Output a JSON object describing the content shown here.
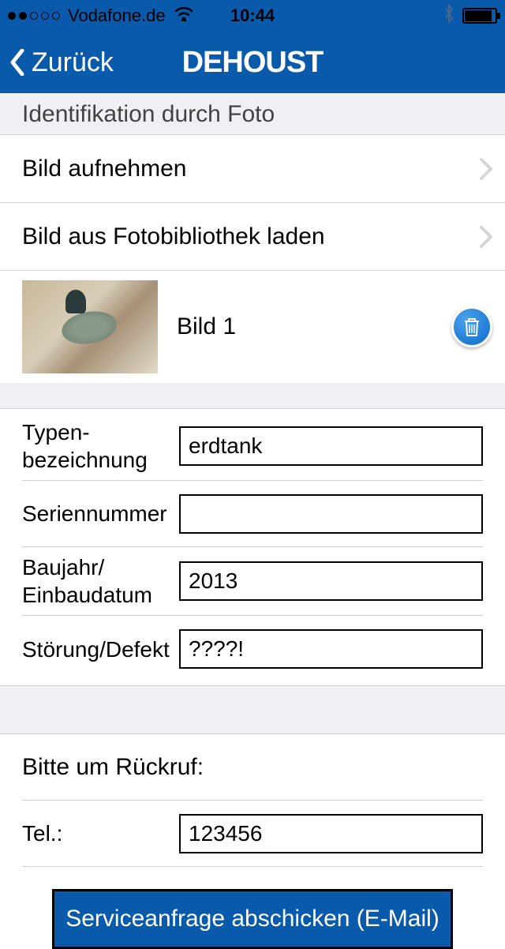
{
  "status": {
    "carrier": "Vodafone.de",
    "time": "10:44"
  },
  "nav": {
    "back": "Zurück",
    "title": "DEHOUST"
  },
  "photo_section": {
    "header": "Identifikation durch Foto",
    "take_photo": "Bild aufnehmen",
    "load_photo": "Bild aus Fotobibliothek laden",
    "image_label": "Bild 1"
  },
  "form": {
    "type_label": "Typen-\nbezeichnung",
    "type_value": "erdtank",
    "serial_label": "Seriennummer",
    "serial_value": "",
    "year_label": "Baujahr/\nEinbaudatum",
    "year_value": "2013",
    "defect_label": "Störung/Defekt",
    "defect_value": "????!"
  },
  "callback": {
    "title": "Bitte um Rückruf:",
    "tel_label": "Tel.:",
    "tel_value": "123456"
  },
  "submit": {
    "label": "Serviceanfrage abschicken (E-Mail)"
  }
}
